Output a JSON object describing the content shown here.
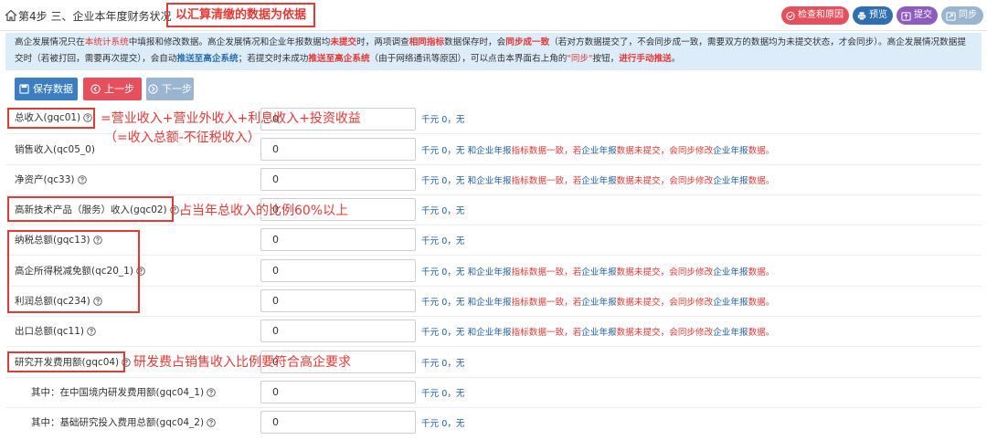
{
  "header": {
    "title": "第4步 三、企业本年度财务状况",
    "title_note": "以汇算清缴的数据为依据",
    "buttons": {
      "check": "检查和原因",
      "preview": "预览",
      "submit": "提交",
      "sync": "同步"
    },
    "colors": {
      "check": "#e6505d",
      "preview": "#2d6fb0",
      "submit": "#8e5bbf",
      "sync": "#9ab5cf"
    }
  },
  "notice": {
    "seg1": "高企发展情况只在",
    "seg2": "本统计系统",
    "seg3": "中填报和修改数据。高企发展情况和企业年报数据均",
    "seg4": "未提交",
    "seg5": "时，两项调查",
    "seg6": "相同指标",
    "seg7": "数据保存时，会",
    "seg8": "同步成一致",
    "seg9": "（若对方数据提交了，不会同步成一致，需要双方的数据均为未提交状态，才会同步）。高企发展情况数据提交时（若被打回，需要再次提交），会自动",
    "seg10": "推送至高企系统",
    "seg11": "；若提交时未成功",
    "seg12": "推送至高企系统",
    "seg13": "（由于网络通讯等原因），可以点击本界面右上角的",
    "seg14": "\"同步\"",
    "seg15": "按钮，",
    "seg16": "进行手动推送",
    "seg17": "。"
  },
  "toolbar": {
    "save": "保存数据",
    "prev": "上一步",
    "next": "下一步"
  },
  "unit_zero": "千元 0，无",
  "consistency": {
    "prefix": "千元 0，无 和",
    "link1": "企业年报",
    "mid": "指标数据一致，若",
    "link2": "企业年报",
    "mid2": "数据未提交，会同步修改",
    "link3": "企业年报",
    "suffix": "数据。"
  },
  "fields": [
    {
      "label": "总收入(gqc01)",
      "value": "0"
    },
    {
      "label": "销售收入(qc05_0)",
      "value": "0"
    },
    {
      "label": "净资产(qc33)",
      "value": "0"
    },
    {
      "label": "高新技术产品（服务）收入(gqc02)",
      "value": "0"
    },
    {
      "label": "纳税总额(gqc13)",
      "value": "0"
    },
    {
      "label": "高企所得税减免额(qc20_1)",
      "value": "0"
    },
    {
      "label": "利润总额(qc234)",
      "value": "0"
    },
    {
      "label": "出口总额(qc11)",
      "value": "0"
    },
    {
      "label": "研究开发费用额(gqc04)",
      "value": "0"
    },
    {
      "label": "其中：在中国境内研发费用额(gqc04_1)",
      "value": "0"
    },
    {
      "label": "其中：基础研究投入费用总额(gqc04_2)",
      "value": "0"
    }
  ],
  "annotations": {
    "total_income_line1": "=营业收入+营业外收入+利息收入+投资收益",
    "total_income_line2": "（=收入总额-不征税收入）",
    "high_tech_ratio": "占当年总收入的比例60%以上",
    "rd_ratio": "研发费占销售收入比例要符合高企要求"
  }
}
